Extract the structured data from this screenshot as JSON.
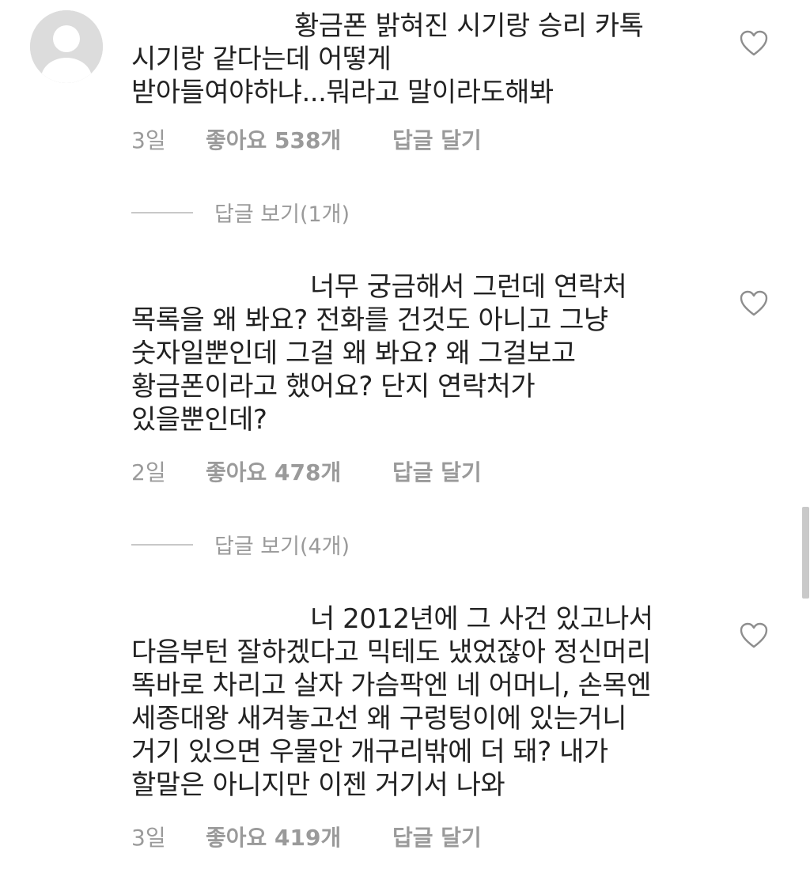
{
  "comments": [
    {
      "text": "황금폰 밝혀진 시기랑 승리 카톡\n시기랑 같다는데 어떻게\n받아들여야하냐...뭐라고 말이라도해봐",
      "age": "3일",
      "likes": "좋아요 538개",
      "reply_label": "답글 달기",
      "view_replies": "답글 보기(1개)"
    },
    {
      "text": "너무 궁금해서 그런데 연락처\n목록을 왜 봐요? 전화를 건것도 아니고 그냥\n숫자일뿐인데 그걸 왜 봐요? 왜 그걸보고\n황금폰이라고 했어요? 단지 연락처가\n있을뿐인데?",
      "age": "2일",
      "likes": "좋아요 478개",
      "reply_label": "답글 달기",
      "view_replies": "답글 보기(4개)"
    },
    {
      "text": "너 2012년에 그 사건 있고나서\n다음부턴 잘하겠다고 믹테도 냈었잖아 정신머리\n똑바로 차리고 살자 가슴팍엔 네 어머니, 손목엔\n세종대왕 새겨놓고선 왜 구렁텅이에 있는거니\n거기 있으면 우물안 개구리밖에 더 돼? 내가\n할말은 아니지만 이젠 거기서 나와",
      "age": "3일",
      "likes": "좋아요 419개",
      "reply_label": "답글 달기"
    }
  ],
  "icons": {
    "like": "heart-outline-icon",
    "avatar": "default-user-avatar"
  },
  "colors": {
    "text": "#222222",
    "meta": "#9a9a9a"
  }
}
